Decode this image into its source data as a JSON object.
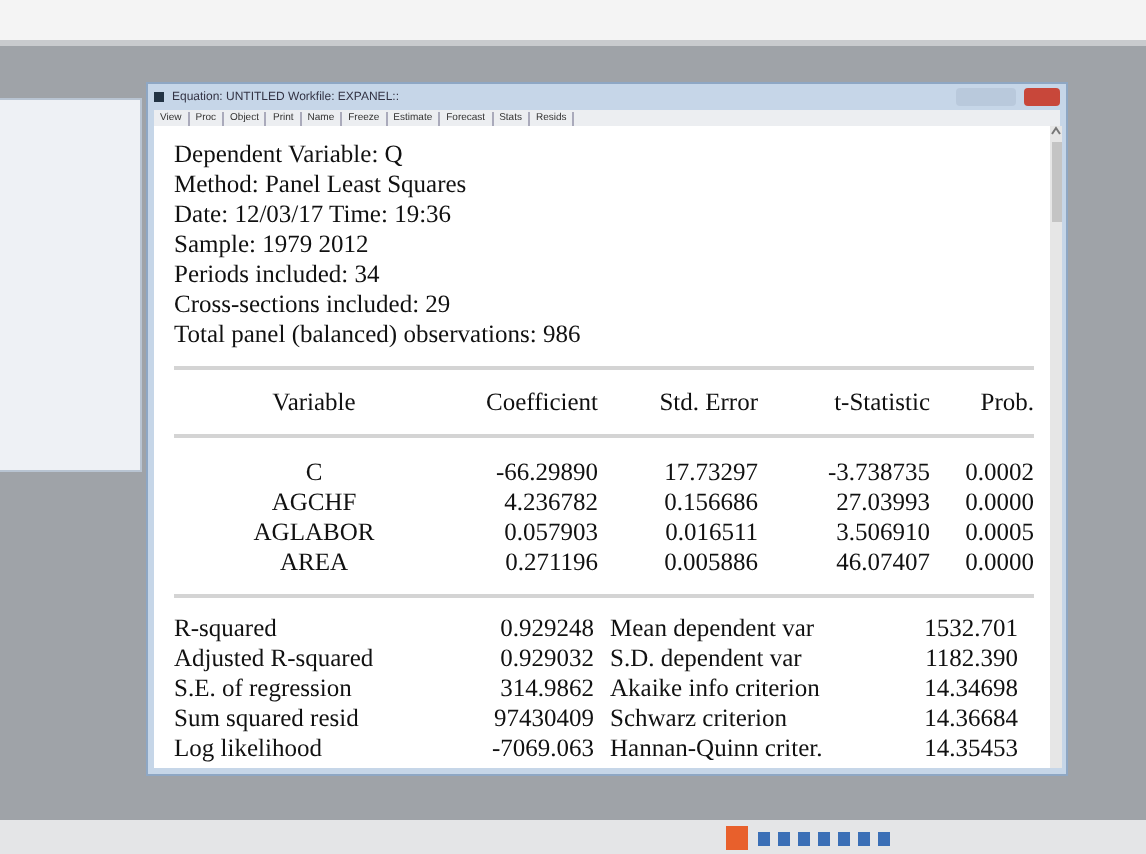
{
  "window": {
    "title": "Equation: UNTITLED   Workfile: EXPANEL::"
  },
  "toolbar": [
    "View",
    "Proc",
    "Object",
    "Print",
    "Name",
    "Freeze",
    "Estimate",
    "Forecast",
    "Stats",
    "Resids"
  ],
  "header": [
    "Dependent Variable: Q",
    "Method: Panel Least Squares",
    "Date: 12/03/17   Time: 19:36",
    "Sample: 1979 2012",
    "Periods included: 34",
    "Cross-sections included: 29",
    "Total panel (balanced) observations: 986"
  ],
  "table": {
    "columns": [
      "Variable",
      "Coefficient",
      "Std. Error",
      "t-Statistic",
      "Prob."
    ],
    "rows": [
      [
        "C",
        "-66.29890",
        "17.73297",
        "-3.738735",
        "0.0002"
      ],
      [
        "AGCHF",
        "4.236782",
        "0.156686",
        "27.03993",
        "0.0000"
      ],
      [
        "AGLABOR",
        "0.057903",
        "0.016511",
        "3.506910",
        "0.0005"
      ],
      [
        "AREA",
        "0.271196",
        "0.005886",
        "46.07407",
        "0.0000"
      ]
    ]
  },
  "stats": [
    [
      "R-squared",
      "0.929248",
      "Mean dependent var",
      "1532.701"
    ],
    [
      "Adjusted R-squared",
      "0.929032",
      "S.D. dependent var",
      "1182.390"
    ],
    [
      "S.E. of regression",
      "314.9862",
      "Akaike info criterion",
      "14.34698"
    ],
    [
      "Sum squared resid",
      "97430409",
      "Schwarz criterion",
      "14.36684"
    ],
    [
      "Log likelihood",
      "-7069.063",
      "Hannan-Quinn criter.",
      "14.35453"
    ]
  ]
}
